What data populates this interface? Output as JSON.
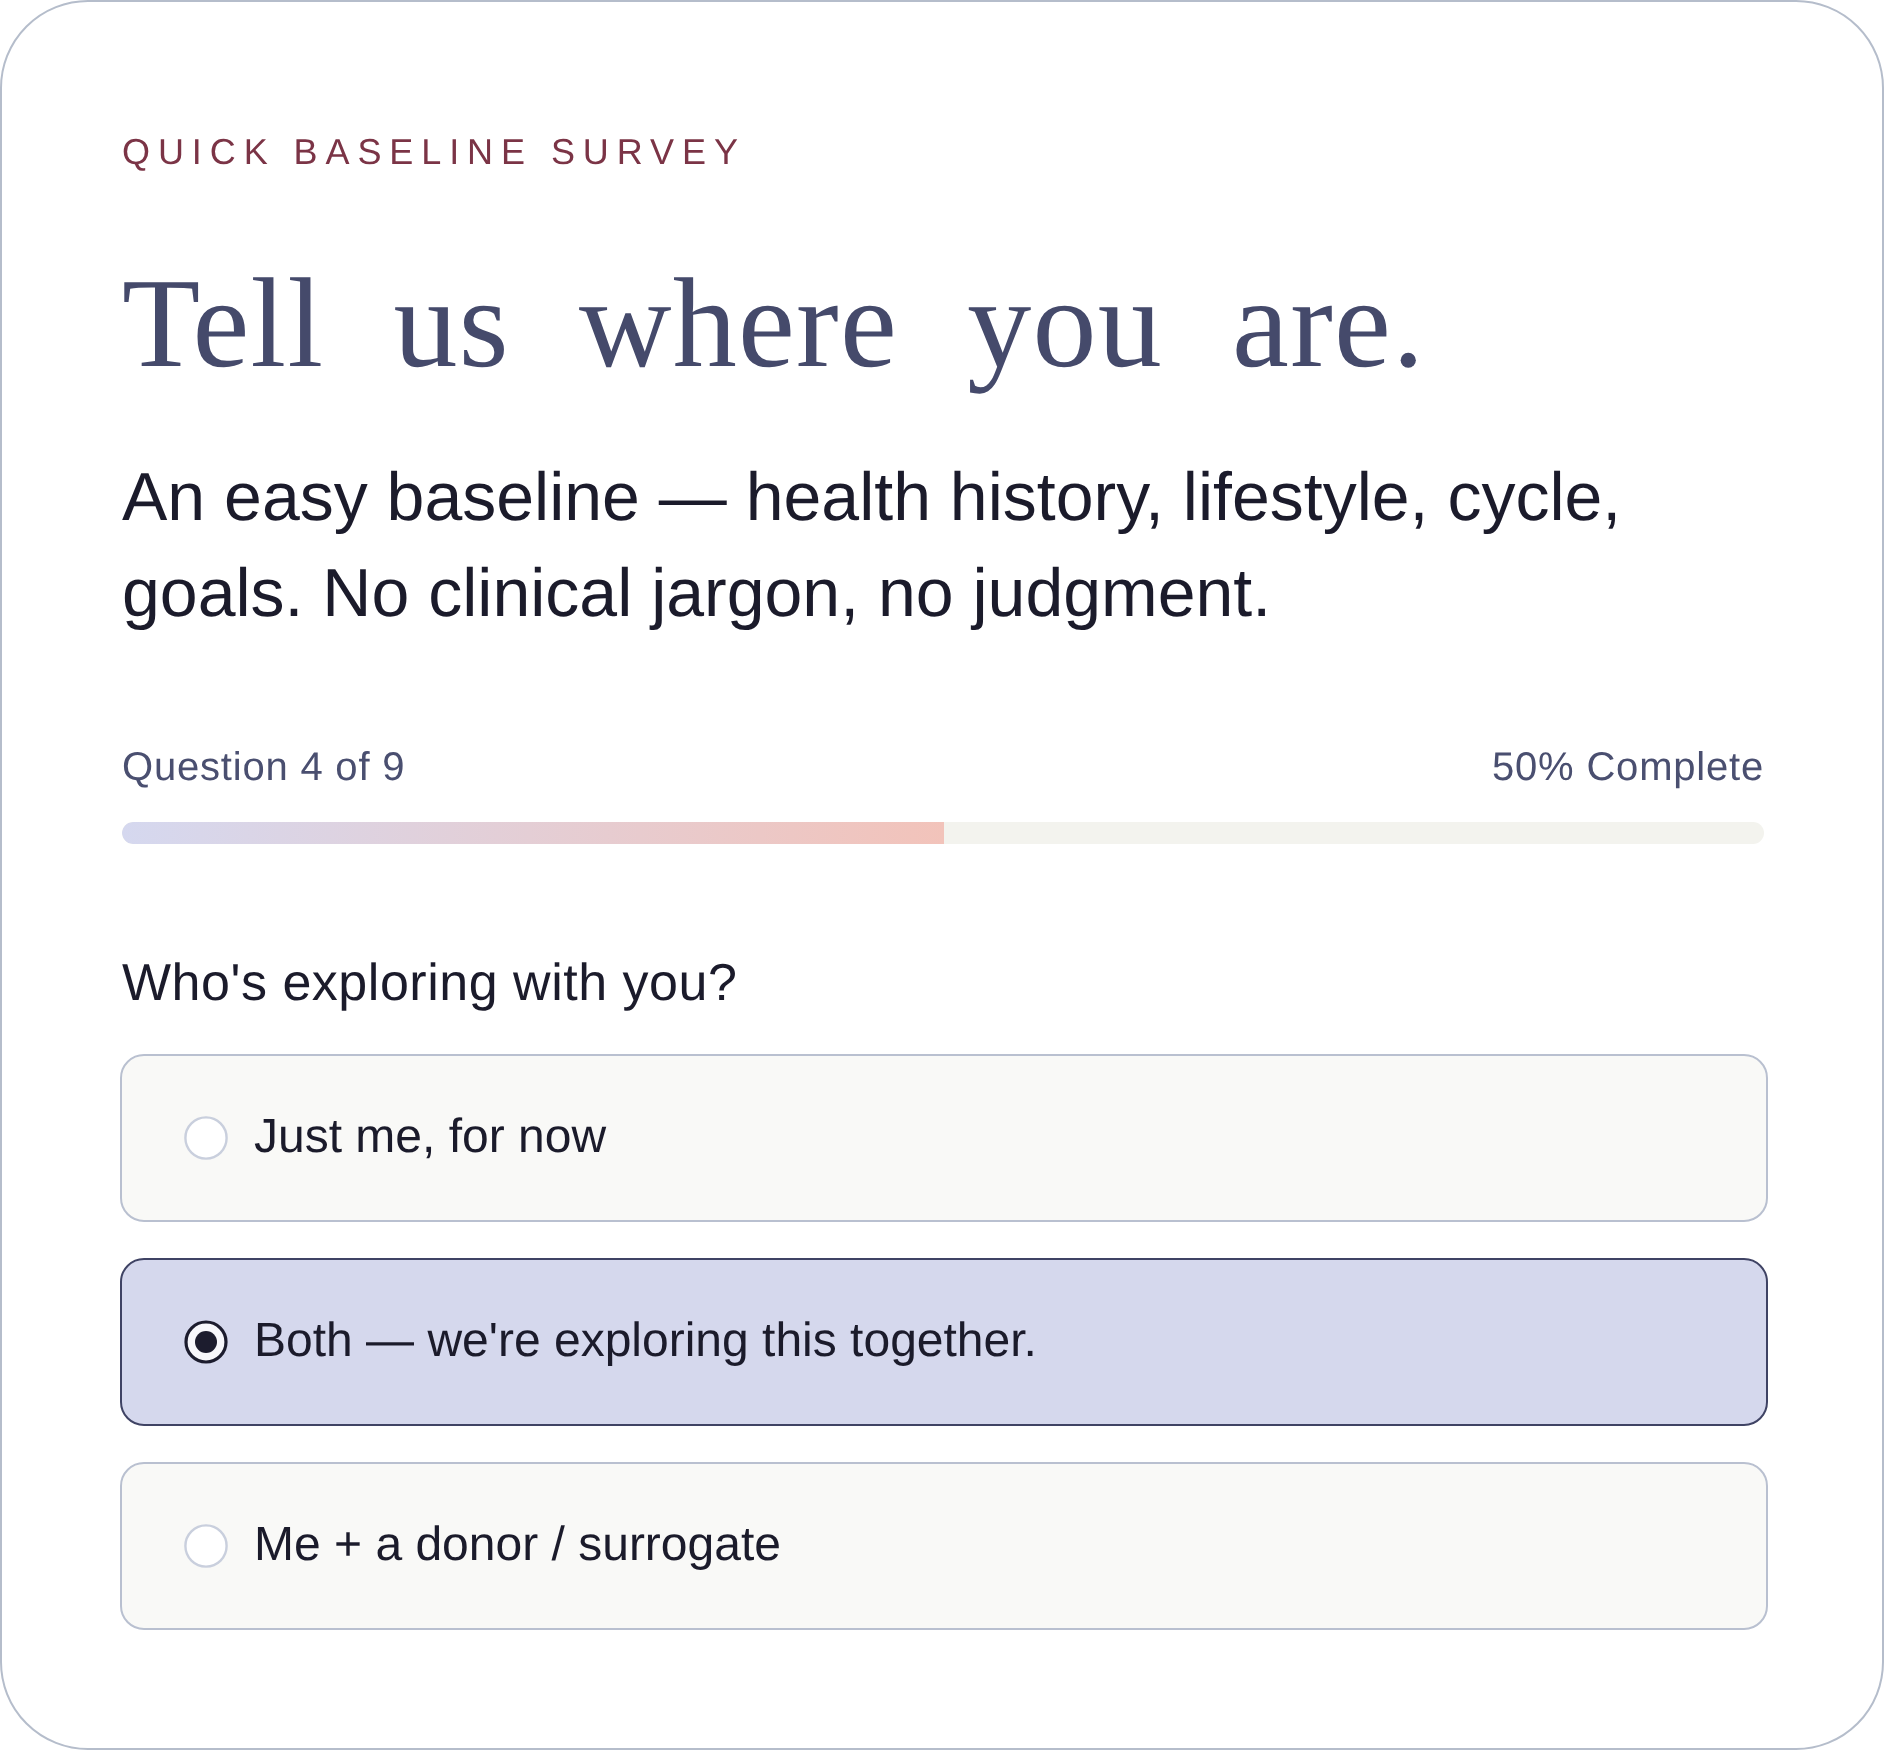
{
  "survey": {
    "eyebrow": "QUICK BASELINE SURVEY",
    "title": "Tell us where you are.",
    "subtitle": "An easy baseline — health history, lifestyle, cycle, goals. No clinical jargon, no judgment."
  },
  "progress": {
    "question_label": "Question 4 of 9",
    "complete_label": "50% Complete",
    "level": 0.5
  },
  "question": {
    "prompt": "Who's exploring with you?",
    "options": [
      {
        "label": "Just me, for now",
        "selected": false
      },
      {
        "label": "Both — we're exploring this together.",
        "selected": true
      },
      {
        "label": "Me + a donor / surrogate",
        "selected": false
      }
    ]
  }
}
